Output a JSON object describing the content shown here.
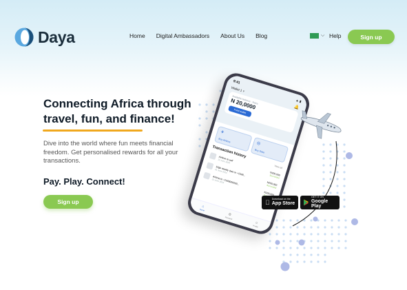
{
  "brand": {
    "name": "Daya",
    "color": "#1a2d3b",
    "accent": "#5aa8e0"
  },
  "nav": {
    "items": [
      "Home",
      "Digital Ambassadors",
      "About Us",
      "Blog"
    ]
  },
  "header": {
    "language_flag": "nigeria-flag-icon",
    "help_label": "Help",
    "signup_label": "Sign up"
  },
  "hero": {
    "title": "Connecting Africa through travel, fun, and finance!",
    "description": "Dive into the world where fun meets financial freedom. Get personalised rewards for all your transactions.",
    "tagline": "Pay. Play. Connect!",
    "signup_label": "Sign up"
  },
  "phone": {
    "time": "9:41",
    "status": "▲ ▮",
    "wallet_label": "Wallet 1 ˅",
    "balance_sublabel": "Available balance · Naira",
    "balance": "N 20,0000",
    "balance_button": "Fund wallet",
    "quick_actions": [
      {
        "icon": "✈",
        "label": "Buy Airtime"
      },
      {
        "icon": "◎",
        "label": "Buy Data"
      }
    ],
    "transactions_title": "Transaction history",
    "transactions_view_all": "View all",
    "transactions": [
      {
        "name": "Airtime to self",
        "date": "21 June 2024",
        "amount": "N200,000",
        "status": "Successful"
      },
      {
        "name": "10gb weekly (two or +2348...",
        "date": "21 June 2024",
        "amount": "N200,000",
        "status": "Successful"
      },
      {
        "name": "Airtime to +2348000000...",
        "date": "21 June 2024",
        "amount": "N200,000",
        "status": "Successful"
      }
    ],
    "tabs": [
      {
        "icon": "⌂",
        "label": "Home",
        "active": true
      },
      {
        "icon": "⚙",
        "label": "Rewards",
        "active": false
      },
      {
        "icon": "☺",
        "label": "Profile",
        "active": false
      }
    ]
  },
  "stores": {
    "apple": {
      "small": "Download on the",
      "big": "App Store",
      "icon": "apple-icon"
    },
    "google": {
      "small": "GET IT ON",
      "big": "Google Play",
      "icon": "google-play-icon"
    }
  },
  "colors": {
    "green": "#8ac952",
    "orange_underline": "#f0a81e",
    "dot_light": "#c9ddf3",
    "dot_accent": "#aeb9e6",
    "title": "#0e1a26"
  }
}
